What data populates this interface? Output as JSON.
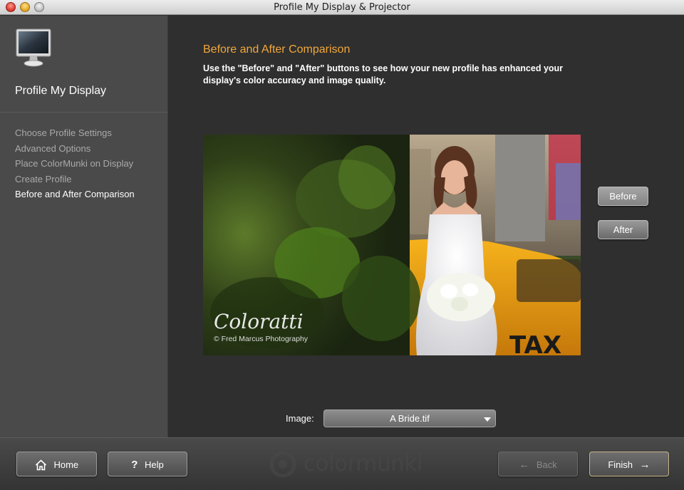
{
  "window": {
    "title": "Profile My Display & Projector"
  },
  "sidebar": {
    "title": "Profile My Display",
    "steps": [
      {
        "label": "Choose Profile Settings",
        "active": false
      },
      {
        "label": "Advanced Options",
        "active": false
      },
      {
        "label": "Place ColorMunki on Display",
        "active": false
      },
      {
        "label": "Create Profile",
        "active": false
      },
      {
        "label": "Before and After Comparison",
        "active": true
      }
    ]
  },
  "main": {
    "heading": "Before and After Comparison",
    "description": "Use the \"Before\" and \"After\" buttons to see how your new profile has enhanced your display's color accuracy and image quality.",
    "photo": {
      "watermark_title": "Coloratti",
      "watermark_credit": "© Fred Marcus Photography",
      "sign_text": "TAX"
    },
    "before_label": "Before",
    "after_label": "After",
    "image_label": "Image:",
    "image_selected": "A Bride.tif"
  },
  "footer": {
    "home_label": "Home",
    "help_label": "Help",
    "back_label": "Back",
    "finish_label": "Finish",
    "brand": "colormunki"
  },
  "colors": {
    "heading_accent": "#f2a73a",
    "sidebar_bg": "#4a4a4a",
    "main_bg": "#2f2f2f"
  },
  "icons": {
    "home": "home-icon",
    "help": "question-mark-icon",
    "back": "arrow-left-icon",
    "finish": "arrow-right-icon",
    "monitor": "monitor-icon",
    "dropdown": "caret-down-icon"
  }
}
